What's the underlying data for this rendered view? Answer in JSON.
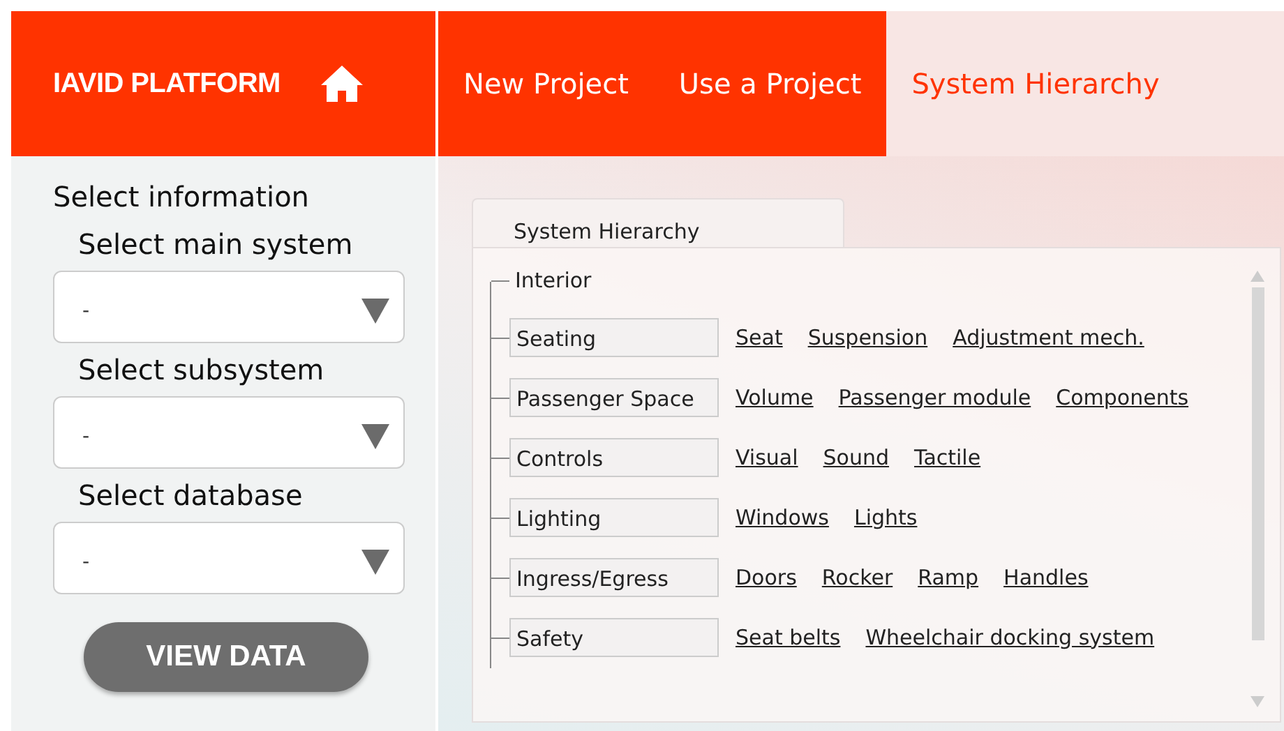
{
  "header": {
    "brand": "IAVID PLATFORM",
    "tabs": [
      {
        "label": "New Project",
        "selected": false
      },
      {
        "label": "Use a Project",
        "selected": false
      },
      {
        "label": "System Hierarchy",
        "selected": true
      }
    ]
  },
  "sidebar": {
    "title": "Select information",
    "fields": [
      {
        "label": "Select main system",
        "value": "-"
      },
      {
        "label": "Select subsystem",
        "value": "-"
      },
      {
        "label": "Select database",
        "value": "-"
      }
    ],
    "button": "VIEW DATA"
  },
  "panel": {
    "tab": "System Hierarchy",
    "tree": {
      "label": "Interior",
      "children": [
        {
          "label": "Seating",
          "links": [
            "Seat",
            "Suspension",
            "Adjustment mech."
          ]
        },
        {
          "label": "Passenger Space",
          "links": [
            "Volume",
            "Passenger module",
            "Components"
          ]
        },
        {
          "label": "Controls",
          "links": [
            "Visual",
            "Sound",
            "Tactile"
          ]
        },
        {
          "label": "Lighting",
          "links": [
            "Windows",
            "Lights"
          ]
        },
        {
          "label": "Ingress/Egress",
          "links": [
            "Doors",
            "Rocker",
            "Ramp",
            "Handles"
          ]
        },
        {
          "label": "Safety",
          "links": [
            "Seat belts",
            "Wheelchair docking system"
          ]
        }
      ]
    }
  }
}
